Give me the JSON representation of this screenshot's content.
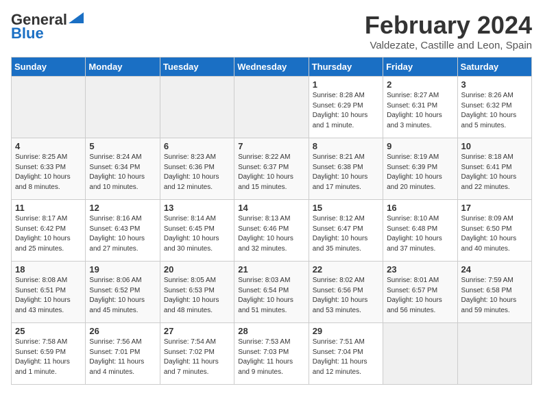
{
  "logo": {
    "line1": "General",
    "line2": "Blue"
  },
  "header": {
    "month": "February 2024",
    "location": "Valdezate, Castille and Leon, Spain"
  },
  "weekdays": [
    "Sunday",
    "Monday",
    "Tuesday",
    "Wednesday",
    "Thursday",
    "Friday",
    "Saturday"
  ],
  "weeks": [
    [
      {
        "day": "",
        "info": ""
      },
      {
        "day": "",
        "info": ""
      },
      {
        "day": "",
        "info": ""
      },
      {
        "day": "",
        "info": ""
      },
      {
        "day": "1",
        "info": "Sunrise: 8:28 AM\nSunset: 6:29 PM\nDaylight: 10 hours\nand 1 minute."
      },
      {
        "day": "2",
        "info": "Sunrise: 8:27 AM\nSunset: 6:31 PM\nDaylight: 10 hours\nand 3 minutes."
      },
      {
        "day": "3",
        "info": "Sunrise: 8:26 AM\nSunset: 6:32 PM\nDaylight: 10 hours\nand 5 minutes."
      }
    ],
    [
      {
        "day": "4",
        "info": "Sunrise: 8:25 AM\nSunset: 6:33 PM\nDaylight: 10 hours\nand 8 minutes."
      },
      {
        "day": "5",
        "info": "Sunrise: 8:24 AM\nSunset: 6:34 PM\nDaylight: 10 hours\nand 10 minutes."
      },
      {
        "day": "6",
        "info": "Sunrise: 8:23 AM\nSunset: 6:36 PM\nDaylight: 10 hours\nand 12 minutes."
      },
      {
        "day": "7",
        "info": "Sunrise: 8:22 AM\nSunset: 6:37 PM\nDaylight: 10 hours\nand 15 minutes."
      },
      {
        "day": "8",
        "info": "Sunrise: 8:21 AM\nSunset: 6:38 PM\nDaylight: 10 hours\nand 17 minutes."
      },
      {
        "day": "9",
        "info": "Sunrise: 8:19 AM\nSunset: 6:39 PM\nDaylight: 10 hours\nand 20 minutes."
      },
      {
        "day": "10",
        "info": "Sunrise: 8:18 AM\nSunset: 6:41 PM\nDaylight: 10 hours\nand 22 minutes."
      }
    ],
    [
      {
        "day": "11",
        "info": "Sunrise: 8:17 AM\nSunset: 6:42 PM\nDaylight: 10 hours\nand 25 minutes."
      },
      {
        "day": "12",
        "info": "Sunrise: 8:16 AM\nSunset: 6:43 PM\nDaylight: 10 hours\nand 27 minutes."
      },
      {
        "day": "13",
        "info": "Sunrise: 8:14 AM\nSunset: 6:45 PM\nDaylight: 10 hours\nand 30 minutes."
      },
      {
        "day": "14",
        "info": "Sunrise: 8:13 AM\nSunset: 6:46 PM\nDaylight: 10 hours\nand 32 minutes."
      },
      {
        "day": "15",
        "info": "Sunrise: 8:12 AM\nSunset: 6:47 PM\nDaylight: 10 hours\nand 35 minutes."
      },
      {
        "day": "16",
        "info": "Sunrise: 8:10 AM\nSunset: 6:48 PM\nDaylight: 10 hours\nand 37 minutes."
      },
      {
        "day": "17",
        "info": "Sunrise: 8:09 AM\nSunset: 6:50 PM\nDaylight: 10 hours\nand 40 minutes."
      }
    ],
    [
      {
        "day": "18",
        "info": "Sunrise: 8:08 AM\nSunset: 6:51 PM\nDaylight: 10 hours\nand 43 minutes."
      },
      {
        "day": "19",
        "info": "Sunrise: 8:06 AM\nSunset: 6:52 PM\nDaylight: 10 hours\nand 45 minutes."
      },
      {
        "day": "20",
        "info": "Sunrise: 8:05 AM\nSunset: 6:53 PM\nDaylight: 10 hours\nand 48 minutes."
      },
      {
        "day": "21",
        "info": "Sunrise: 8:03 AM\nSunset: 6:54 PM\nDaylight: 10 hours\nand 51 minutes."
      },
      {
        "day": "22",
        "info": "Sunrise: 8:02 AM\nSunset: 6:56 PM\nDaylight: 10 hours\nand 53 minutes."
      },
      {
        "day": "23",
        "info": "Sunrise: 8:01 AM\nSunset: 6:57 PM\nDaylight: 10 hours\nand 56 minutes."
      },
      {
        "day": "24",
        "info": "Sunrise: 7:59 AM\nSunset: 6:58 PM\nDaylight: 10 hours\nand 59 minutes."
      }
    ],
    [
      {
        "day": "25",
        "info": "Sunrise: 7:58 AM\nSunset: 6:59 PM\nDaylight: 11 hours\nand 1 minute."
      },
      {
        "day": "26",
        "info": "Sunrise: 7:56 AM\nSunset: 7:01 PM\nDaylight: 11 hours\nand 4 minutes."
      },
      {
        "day": "27",
        "info": "Sunrise: 7:54 AM\nSunset: 7:02 PM\nDaylight: 11 hours\nand 7 minutes."
      },
      {
        "day": "28",
        "info": "Sunrise: 7:53 AM\nSunset: 7:03 PM\nDaylight: 11 hours\nand 9 minutes."
      },
      {
        "day": "29",
        "info": "Sunrise: 7:51 AM\nSunset: 7:04 PM\nDaylight: 11 hours\nand 12 minutes."
      },
      {
        "day": "",
        "info": ""
      },
      {
        "day": "",
        "info": ""
      }
    ]
  ]
}
